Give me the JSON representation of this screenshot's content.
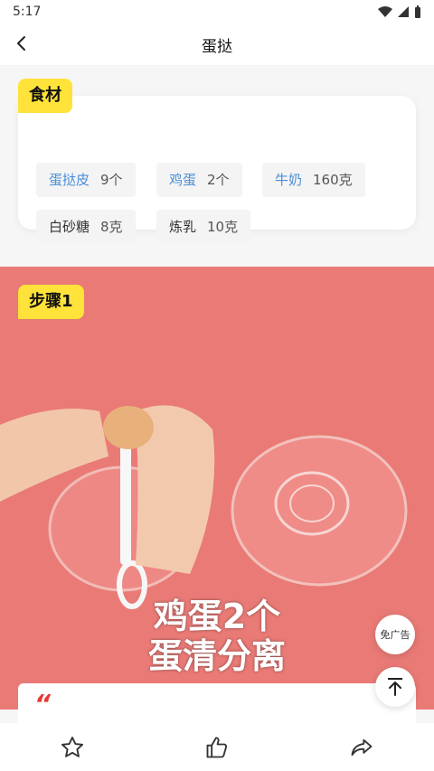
{
  "status_bar": {
    "time": "5:17"
  },
  "header": {
    "title": "蛋挞"
  },
  "ingredients": {
    "tag": "食材",
    "items": [
      {
        "name": "蛋挞皮",
        "amount": "9个",
        "link": true
      },
      {
        "name": "鸡蛋",
        "amount": "2个",
        "link": true
      },
      {
        "name": "牛奶",
        "amount": "160克",
        "link": true
      },
      {
        "name": "白砂糖",
        "amount": "8克",
        "link": false
      },
      {
        "name": "炼乳",
        "amount": "10克",
        "link": false
      }
    ]
  },
  "step": {
    "tag": "步骤1",
    "caption_line1": "鸡蛋2个",
    "caption_line2": "蛋清分离",
    "quote": "“"
  },
  "floating": {
    "no_ads_label": "免广告"
  },
  "bottom_bar": {
    "icons": [
      "star-icon",
      "thumbs-up-icon",
      "share-icon"
    ]
  },
  "colors": {
    "accent_yellow": "#ffe23a",
    "link_blue": "#4a8fd8",
    "background_pink": "#e97a76"
  }
}
